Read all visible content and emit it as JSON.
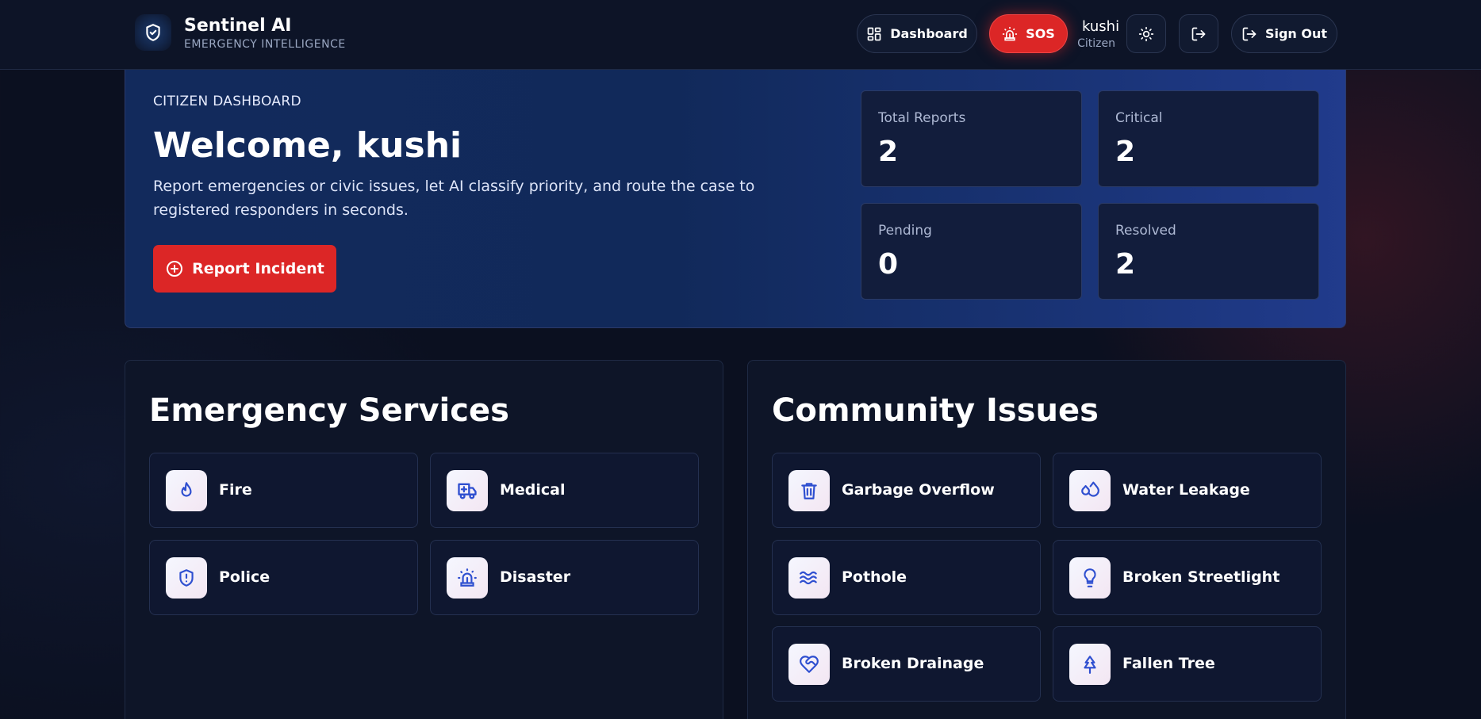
{
  "header": {
    "brand_title": "Sentinel AI",
    "brand_subtitle": "EMERGENCY INTELLIGENCE",
    "dashboard_label": "Dashboard",
    "sos_label": "SOS",
    "user_name": "kushi",
    "user_role": "Citizen",
    "signout_label": "Sign Out"
  },
  "hero": {
    "kicker": "CITIZEN DASHBOARD",
    "title": "Welcome, kushi",
    "description": "Report emergencies or civic issues, let AI classify priority, and route the case to registered responders in seconds.",
    "report_label": "Report Incident",
    "stats": [
      {
        "label": "Total Reports",
        "value": "2"
      },
      {
        "label": "Critical",
        "value": "2"
      },
      {
        "label": "Pending",
        "value": "0"
      },
      {
        "label": "Resolved",
        "value": "2"
      }
    ]
  },
  "emergency": {
    "title": "Emergency Services",
    "items": [
      {
        "label": "Fire",
        "icon": "flame-icon"
      },
      {
        "label": "Medical",
        "icon": "ambulance-icon"
      },
      {
        "label": "Police",
        "icon": "shield-alert-icon"
      },
      {
        "label": "Disaster",
        "icon": "siren-icon"
      }
    ]
  },
  "community": {
    "title": "Community Issues",
    "items": [
      {
        "label": "Garbage Overflow",
        "icon": "trash-icon"
      },
      {
        "label": "Water Leakage",
        "icon": "droplets-icon"
      },
      {
        "label": "Pothole",
        "icon": "waves-icon"
      },
      {
        "label": "Broken Streetlight",
        "icon": "lightbulb-icon"
      },
      {
        "label": "Broken Drainage",
        "icon": "heart-handshake-icon"
      },
      {
        "label": "Fallen Tree",
        "icon": "tree-icon"
      }
    ]
  },
  "colors": {
    "background": "#0b1020",
    "accent_red": "#dc2626",
    "icon_blue": "#2f4fd0",
    "hero_blue": "#122a5c"
  }
}
